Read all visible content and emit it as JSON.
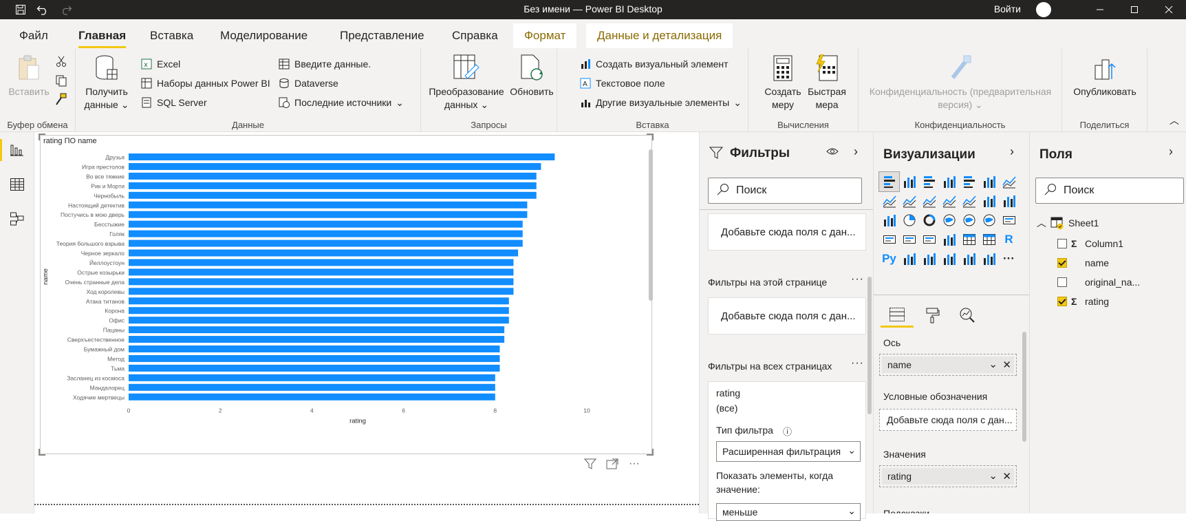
{
  "window": {
    "title": "Без имени — Power BI Desktop",
    "sign_in": "Войти"
  },
  "tabs": [
    {
      "label": "Файл"
    },
    {
      "label": "Главная"
    },
    {
      "label": "Вставка"
    },
    {
      "label": "Моделирование"
    },
    {
      "label": "Представление"
    },
    {
      "label": "Справка"
    },
    {
      "label": "Формат"
    },
    {
      "label": "Данные и детализация"
    }
  ],
  "ribbon": {
    "clipboard": {
      "paste": "Вставить",
      "label": "Буфер обмена"
    },
    "data": {
      "get_data_1": "Получить",
      "get_data_2": "данные",
      "excel": "Excel",
      "powerbi_datasets": "Наборы данных Power BI",
      "sql": "SQL Server",
      "enter_data": "Введите данные.",
      "dataverse": "Dataverse",
      "recent": "Последние источники",
      "label": "Данные"
    },
    "queries": {
      "transform_1": "Преобразование",
      "transform_2": "данных",
      "refresh": "Обновить",
      "label": "Запросы"
    },
    "insert": {
      "new_visual": "Создать визуальный элемент",
      "text_box": "Текстовое поле",
      "more_visuals": "Другие визуальные элементы",
      "label": "Вставка"
    },
    "calculations": {
      "new_measure_1": "Создать",
      "new_measure_2": "меру",
      "quick_measure_1": "Быстрая",
      "quick_measure_2": "мера",
      "label": "Вычисления"
    },
    "sensitivity": {
      "btn_1": "Конфиденциальность (предварительная",
      "btn_2": "версия)",
      "label": "Конфиденциальность"
    },
    "share": {
      "publish": "Опубликовать",
      "label": "Поделиться"
    }
  },
  "visual": {
    "title": "rating ПО name"
  },
  "chart_data": {
    "type": "bar",
    "orientation": "horizontal",
    "title": "rating ПО name",
    "xlabel": "rating",
    "ylabel": "name",
    "xlim": [
      0,
      10
    ],
    "xticks": [
      "0",
      "2",
      "4",
      "6",
      "8",
      "10"
    ],
    "color": "#118dff",
    "categories": [
      "Друзья",
      "Игра престолов",
      "Во все тяжкие",
      "Рик и Морти",
      "Чернобыль",
      "Настоящий детектив",
      "Постучись в мою дверь",
      "Бесстыжие",
      "Голяк",
      "Теория большого взрыва",
      "Черное зеркало",
      "Йеллоустоун",
      "Острые козырьки",
      "Очень странные дела",
      "Ход королевы",
      "Атака титанов",
      "Корона",
      "Офис",
      "Пацаны",
      "Сверхъестественное",
      "Бумажный дом",
      "Метод",
      "Тьма",
      "Засланец из космоса",
      "Мандалорец",
      "Ходячие мертвецы"
    ],
    "values": [
      9.3,
      9.0,
      8.9,
      8.9,
      8.9,
      8.7,
      8.7,
      8.6,
      8.6,
      8.6,
      8.5,
      8.4,
      8.4,
      8.4,
      8.4,
      8.3,
      8.3,
      8.3,
      8.2,
      8.2,
      8.1,
      8.1,
      8.1,
      8.0,
      8.0,
      8.0
    ]
  },
  "filters": {
    "title": "Фильтры",
    "search_placeholder": "Поиск",
    "drop_visual": "Добавьте сюда поля с дан...",
    "page_section": "Фильтры на этой странице",
    "drop_page": "Добавьте сюда поля с дан...",
    "all_pages_section": "Фильтры на всех страницах",
    "card": {
      "field": "rating",
      "state": "(все)",
      "type_label": "Тип фильтра",
      "type_value": "Расширенная фильтрация",
      "show_label_1": "Показать элементы, когда",
      "show_label_2": "значение:",
      "operator": "меньше"
    }
  },
  "visualizations": {
    "title": "Визуализации",
    "axis_label": "Ось",
    "axis_field": "name",
    "legend_label": "Условные обозначения",
    "legend_drop": "Добавьте сюда поля с дан...",
    "values_label": "Значения",
    "values_field": "rating",
    "tooltips_label": "Подсказки",
    "r_label": "R",
    "py_label": "Py",
    "more": "···"
  },
  "fields": {
    "title": "Поля",
    "search_placeholder": "Поиск",
    "table": "Sheet1",
    "items": [
      {
        "name": "Column1",
        "checked": false,
        "sigma": true
      },
      {
        "name": "name",
        "checked": true,
        "sigma": false
      },
      {
        "name": "original_na...",
        "checked": false,
        "sigma": false
      },
      {
        "name": "rating",
        "checked": true,
        "sigma": true
      }
    ]
  }
}
